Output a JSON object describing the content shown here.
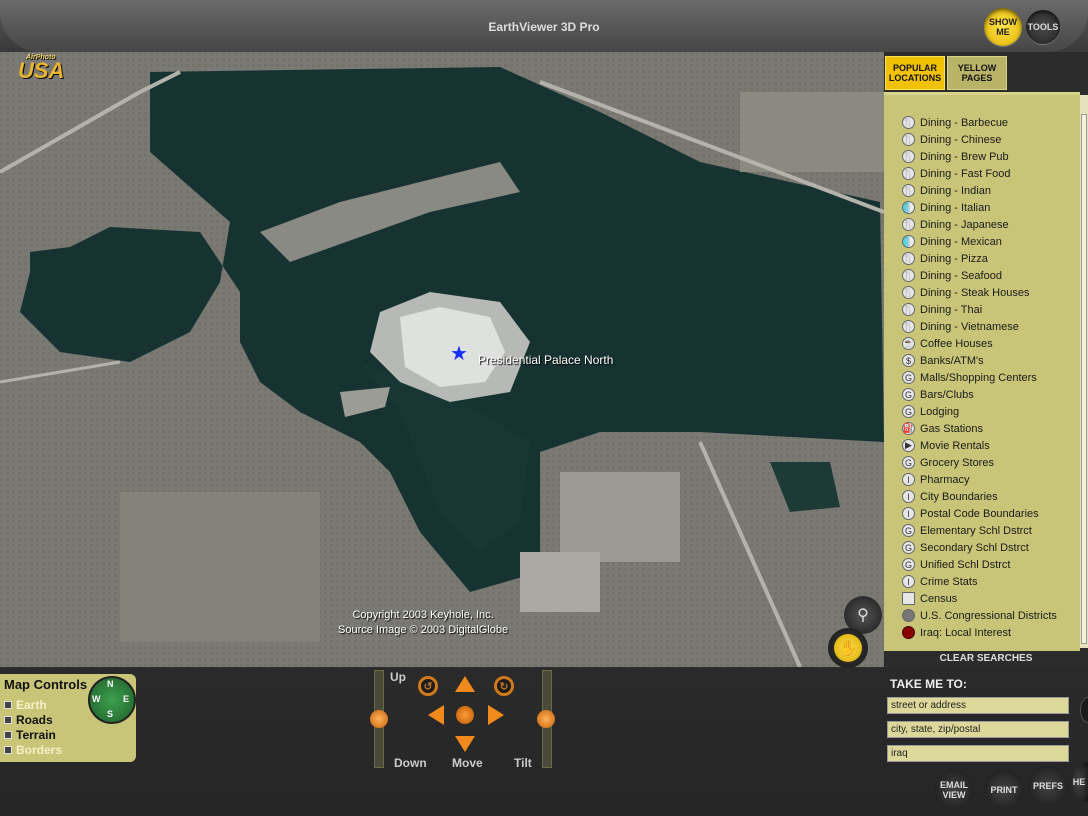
{
  "app": {
    "title": "EarthViewer 3D Pro",
    "logo_small": "AirPhoto",
    "logo_text": "USA"
  },
  "header": {
    "show_me_label": "SHOW ME",
    "tools_label": "TOOLS"
  },
  "map": {
    "place_label": "Presidential Palace North",
    "copyright_line1": "Copyright 2003 Keyhole, Inc.",
    "copyright_line2": "Source Image © 2003 DigitalGlobe"
  },
  "sidebar": {
    "tabs": [
      {
        "label": "POPULAR LOCATIONS"
      },
      {
        "label": "YELLOW PAGES"
      }
    ],
    "items": [
      {
        "label": "Dining - Barbecue",
        "icon": "dining-icon"
      },
      {
        "label": "Dining - Chinese",
        "icon": "dining-icon"
      },
      {
        "label": "Dining - Brew Pub",
        "icon": "dining-icon"
      },
      {
        "label": "Dining - Fast Food",
        "icon": "dining-icon"
      },
      {
        "label": "Dining - Indian",
        "icon": "dining-icon"
      },
      {
        "label": "Dining - Italian",
        "icon": "dining-icon"
      },
      {
        "label": "Dining - Japanese",
        "icon": "dining-icon"
      },
      {
        "label": "Dining - Mexican",
        "icon": "dining-icon"
      },
      {
        "label": "Dining - Pizza",
        "icon": "dining-icon"
      },
      {
        "label": "Dining - Seafood",
        "icon": "dining-icon"
      },
      {
        "label": "Dining - Steak Houses",
        "icon": "dining-icon"
      },
      {
        "label": "Dining - Thai",
        "icon": "dining-icon"
      },
      {
        "label": "Dining - Vietnamese",
        "icon": "dining-icon"
      },
      {
        "label": "Coffee Houses",
        "icon": "coffee-icon"
      },
      {
        "label": "Banks/ATM's",
        "icon": "bank-icon"
      },
      {
        "label": "Malls/Shopping Centers",
        "icon": "mall-icon"
      },
      {
        "label": "Bars/Clubs",
        "icon": "bar-icon"
      },
      {
        "label": "Lodging",
        "icon": "lodging-icon"
      },
      {
        "label": "Gas Stations",
        "icon": "gas-icon"
      },
      {
        "label": "Movie Rentals",
        "icon": "movie-icon"
      },
      {
        "label": "Grocery Stores",
        "icon": "grocery-icon"
      },
      {
        "label": "Pharmacy",
        "icon": "pharmacy-icon"
      },
      {
        "label": "City Boundaries",
        "icon": "boundary-icon"
      },
      {
        "label": "Postal Code Boundaries",
        "icon": "boundary-icon"
      },
      {
        "label": "Elementary Schl Dstrct",
        "icon": "school-icon"
      },
      {
        "label": "Secondary Schl Dstrct",
        "icon": "school-icon"
      },
      {
        "label": "Unified Schl Dstrct",
        "icon": "school-icon"
      },
      {
        "label": "Crime Stats",
        "icon": "crime-icon"
      },
      {
        "label": "Census",
        "icon": "census-icon"
      },
      {
        "label": "U.S. Congressional Districts",
        "icon": "congress-icon"
      },
      {
        "label": "Iraq: Local Interest",
        "icon": "iraq-icon"
      }
    ],
    "clear_label": "CLEAR SEARCHES"
  },
  "map_controls": {
    "title": "Map Controls",
    "layers": [
      {
        "label": "Earth",
        "active": false
      },
      {
        "label": "Roads",
        "active": true
      },
      {
        "label": "Terrain",
        "active": true
      },
      {
        "label": "Borders",
        "active": false
      }
    ],
    "compass": {
      "n": "N",
      "e": "E",
      "s": "S",
      "w": "W"
    }
  },
  "navigation": {
    "up_label": "Up",
    "down_label": "Down",
    "move_label": "Move",
    "tilt_label": "Tilt"
  },
  "take_me_to": {
    "label": "TAKE ME TO:",
    "street": "street or address",
    "city": "city, state, zip/postal",
    "query": "iraq"
  },
  "footer_buttons": {
    "email": "EMAIL VIEW",
    "print": "PRINT",
    "prefs": "PREFS",
    "help": "HE"
  },
  "colors": {
    "accent": "#f2c200",
    "panel": "#c9c578",
    "nav_orange": "#f08a1c"
  }
}
